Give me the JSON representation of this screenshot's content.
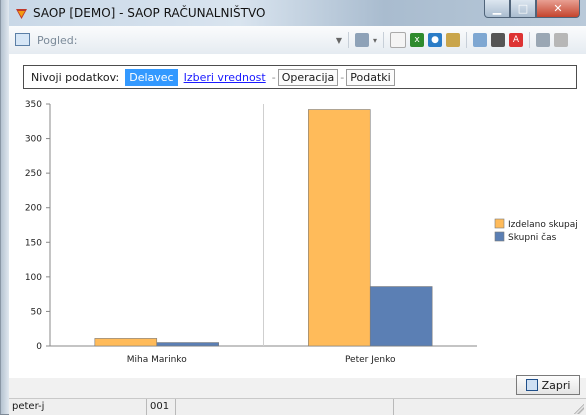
{
  "window": {
    "title": "SAOP  [DEMO] - SAOP RAČUNALNIŠTVO"
  },
  "toolbar": {
    "view_label": "Pogled:"
  },
  "crumbs": {
    "title": "Nivoji podatkov:",
    "items": [
      "Delavec",
      "Izberi vrednost",
      "Operacija",
      "Podatki"
    ]
  },
  "chart_data": {
    "type": "bar",
    "categories": [
      "Miha Marinko",
      "Peter Jenko"
    ],
    "series": [
      {
        "name": "Izdelano skupaj",
        "values": [
          11,
          342
        ],
        "color": "#ffbb5a"
      },
      {
        "name": "Skupni čas",
        "values": [
          5,
          86
        ],
        "color": "#5b7fb4"
      }
    ],
    "ylim": [
      0,
      350
    ],
    "yticks": [
      0,
      50,
      100,
      150,
      200,
      250,
      300,
      350
    ],
    "grid": true,
    "legend_position": "right"
  },
  "buttons": {
    "close": "Zapri"
  },
  "status": {
    "user": "peter-j",
    "code": "001"
  }
}
